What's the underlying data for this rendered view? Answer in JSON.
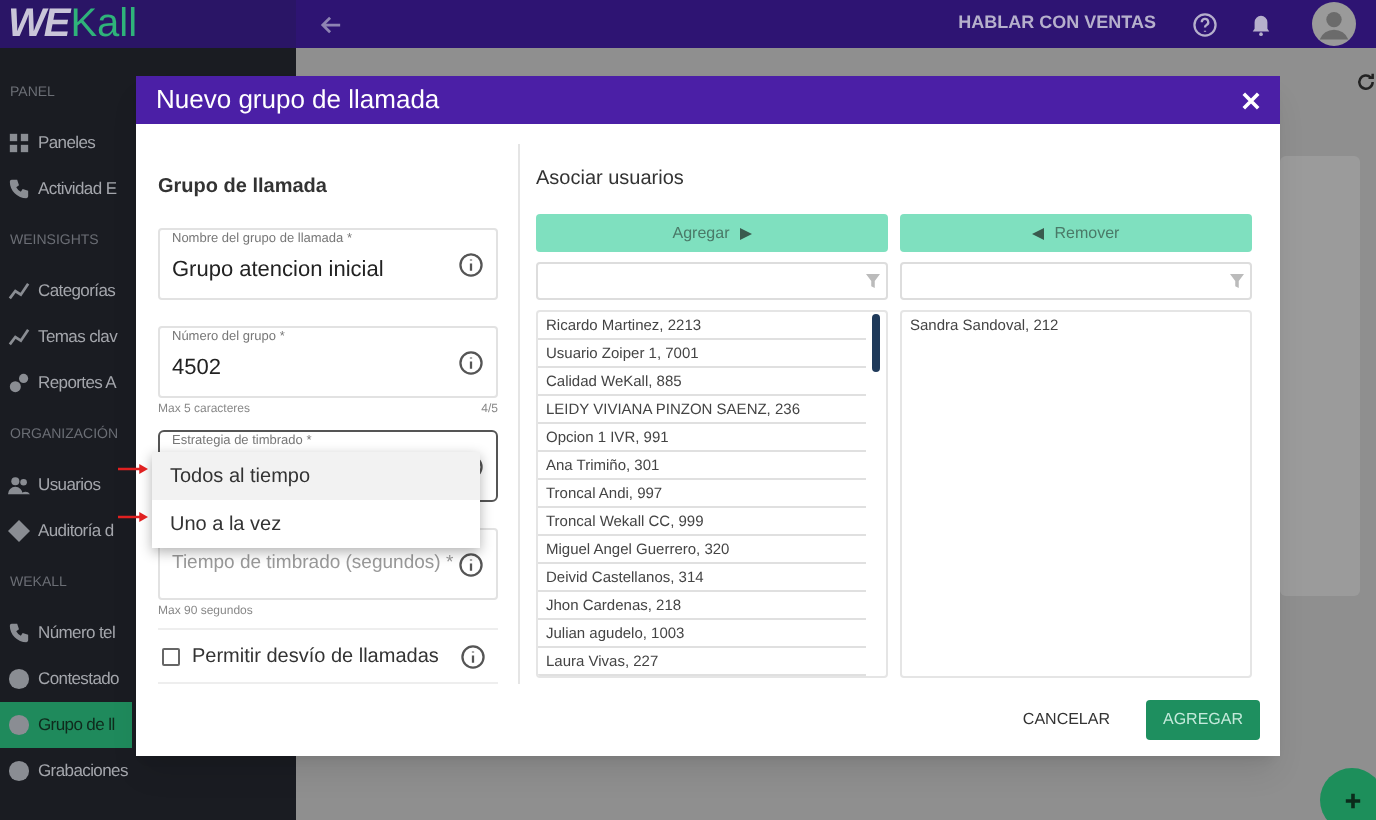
{
  "logo": {
    "part_1": "WE",
    "part_2": "Kall"
  },
  "top_bar": {
    "sales_link": "HABLAR CON VENTAS"
  },
  "sidebar": {
    "sections": [
      {
        "title": "PANEL",
        "items": [
          {
            "label": "Paneles",
            "selected": false,
            "kind": "grid"
          },
          {
            "label": "Actividad E",
            "selected": false,
            "kind": "phone"
          }
        ]
      },
      {
        "title": "WEINSIGHTS",
        "items": [
          {
            "label": "Categorías",
            "selected": false,
            "kind": "trend"
          },
          {
            "label": "Temas clav",
            "selected": false,
            "kind": "trend"
          },
          {
            "label": "Reportes A",
            "selected": false,
            "kind": "report"
          }
        ]
      },
      {
        "title": "ORGANIZACIÓN",
        "items": [
          {
            "label": "Usuarios",
            "selected": false,
            "kind": "users"
          },
          {
            "label": "Auditoría d",
            "selected": false,
            "kind": "diamond"
          }
        ]
      },
      {
        "title": "WEKALL",
        "items": [
          {
            "label": "Número tel",
            "selected": false,
            "kind": "phone"
          },
          {
            "label": "Contestado",
            "selected": false,
            "kind": "circle"
          },
          {
            "label": "Grupo de ll",
            "selected": true,
            "kind": "circle"
          },
          {
            "label": "Grabaciones",
            "selected": false,
            "kind": "circle"
          }
        ]
      }
    ]
  },
  "dialog": {
    "title": "Nuevo grupo de llamada",
    "form": {
      "heading": "Grupo de llamada",
      "fields": [
        {
          "label": "Nombre del grupo de llamada *",
          "value": "Grupo atencion inicial"
        },
        {
          "label": "Número del grupo *",
          "value": "4502",
          "hint": "Max 5 caracteres",
          "counter": "4/5"
        },
        {
          "label": "Estrategia de timbrado *",
          "kind": "select",
          "expanded": true,
          "options": [
            {
              "label": "Todos al tiempo",
              "selected": true
            },
            {
              "label": "Uno a la vez",
              "selected": false
            }
          ]
        },
        {
          "placeholder": "Tiempo de timbrado (segundos) *",
          "hint": "Max 90 segundos"
        }
      ],
      "checkbox": {
        "label": "Permitir desvío de llamadas",
        "checked": false
      }
    },
    "users": {
      "heading": "Asociar usuarios",
      "add_button": "Agregar",
      "remove_button": "Remover",
      "available": [
        "Ricardo Martinez, 2213",
        "Usuario Zoiper 1, 7001",
        "Calidad WeKall, 885",
        "LEIDY VIVIANA PINZON SAENZ, 236",
        "Opcion 1 IVR, 991",
        "Ana Trimiño, 301",
        "Troncal Andi, 997",
        "Troncal Wekall CC, 999",
        "Miguel Angel Guerrero, 320",
        "Deivid Castellanos, 314",
        "Jhon Cardenas, 218",
        "Julian agudelo, 1003",
        "Laura Vivas, 227"
      ],
      "assigned": [
        "Sandra Sandoval, 212"
      ]
    },
    "cancel_button": "CANCELAR",
    "submit_button": {
      "label": "AGREGAR",
      "disabled": true
    }
  }
}
